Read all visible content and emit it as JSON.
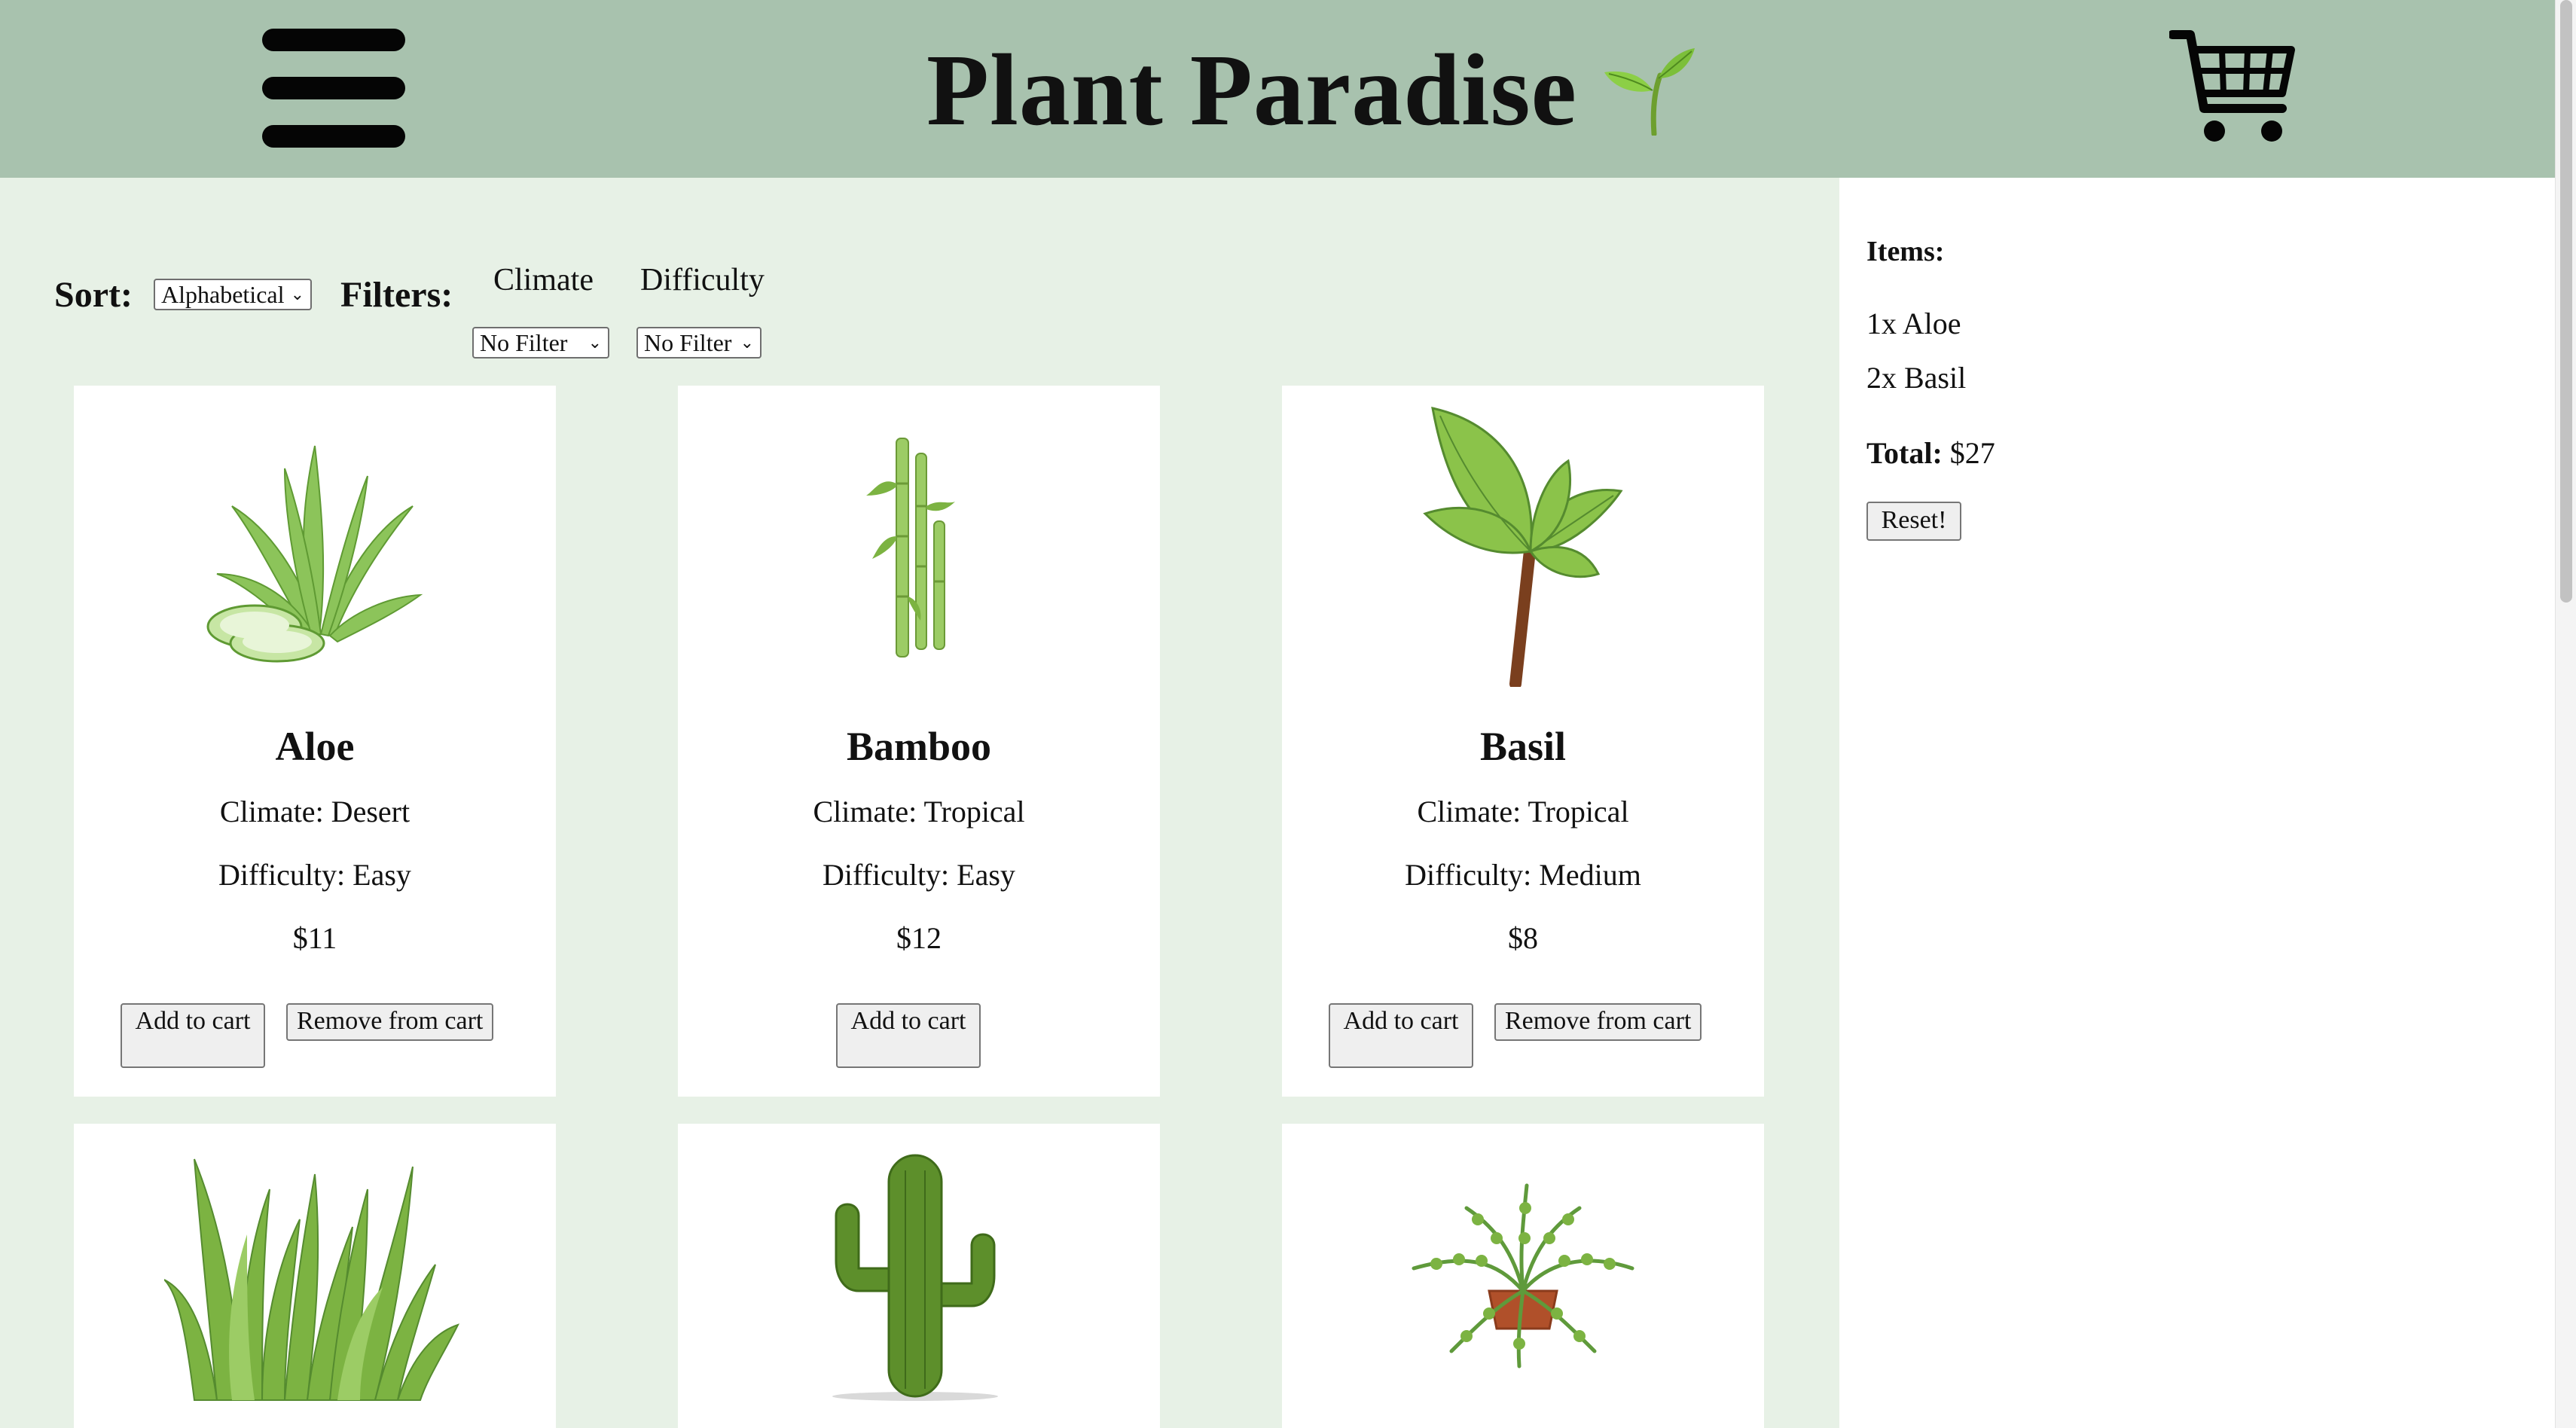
{
  "header": {
    "title": "Plant Paradise",
    "title_icon": "seedling-icon",
    "menu_icon": "hamburger-menu-icon",
    "cart_icon": "shopping-cart-icon",
    "background_color": "#a8c2ae"
  },
  "controls": {
    "sort_label": "Sort:",
    "sort_value": "Alphabetical",
    "filters_label": "Filters:",
    "climate_heading": "Climate",
    "climate_value": "No Filter",
    "difficulty_heading": "Difficulty",
    "difficulty_value": "No Filter"
  },
  "products": [
    {
      "name": "Aloe",
      "climate": "Climate: Desert",
      "difficulty": "Difficulty: Easy",
      "price": "$11",
      "add_label": "Add to cart",
      "remove_label": "Remove from cart",
      "image": "aloe-plant"
    },
    {
      "name": "Bamboo",
      "climate": "Climate: Tropical",
      "difficulty": "Difficulty: Easy",
      "price": "$12",
      "add_label": "Add to cart",
      "image": "bamboo-plant"
    },
    {
      "name": "Basil",
      "climate": "Climate: Tropical",
      "difficulty": "Difficulty: Medium",
      "price": "$8",
      "add_label": "Add to cart",
      "remove_label": "Remove from cart",
      "image": "basil-plant"
    },
    {
      "image": "grass-plant"
    },
    {
      "image": "cactus-plant"
    },
    {
      "image": "fern-plant"
    }
  ],
  "cart": {
    "items_label": "Items:",
    "lines": [
      "1x  Aloe",
      "2x  Basil"
    ],
    "total_label": "Total:",
    "total_value": "$27",
    "reset_label": "Reset!"
  },
  "colors": {
    "page_background": "#e7f1e6",
    "card_background": "#ffffff",
    "plant_green": "#7cb342"
  }
}
